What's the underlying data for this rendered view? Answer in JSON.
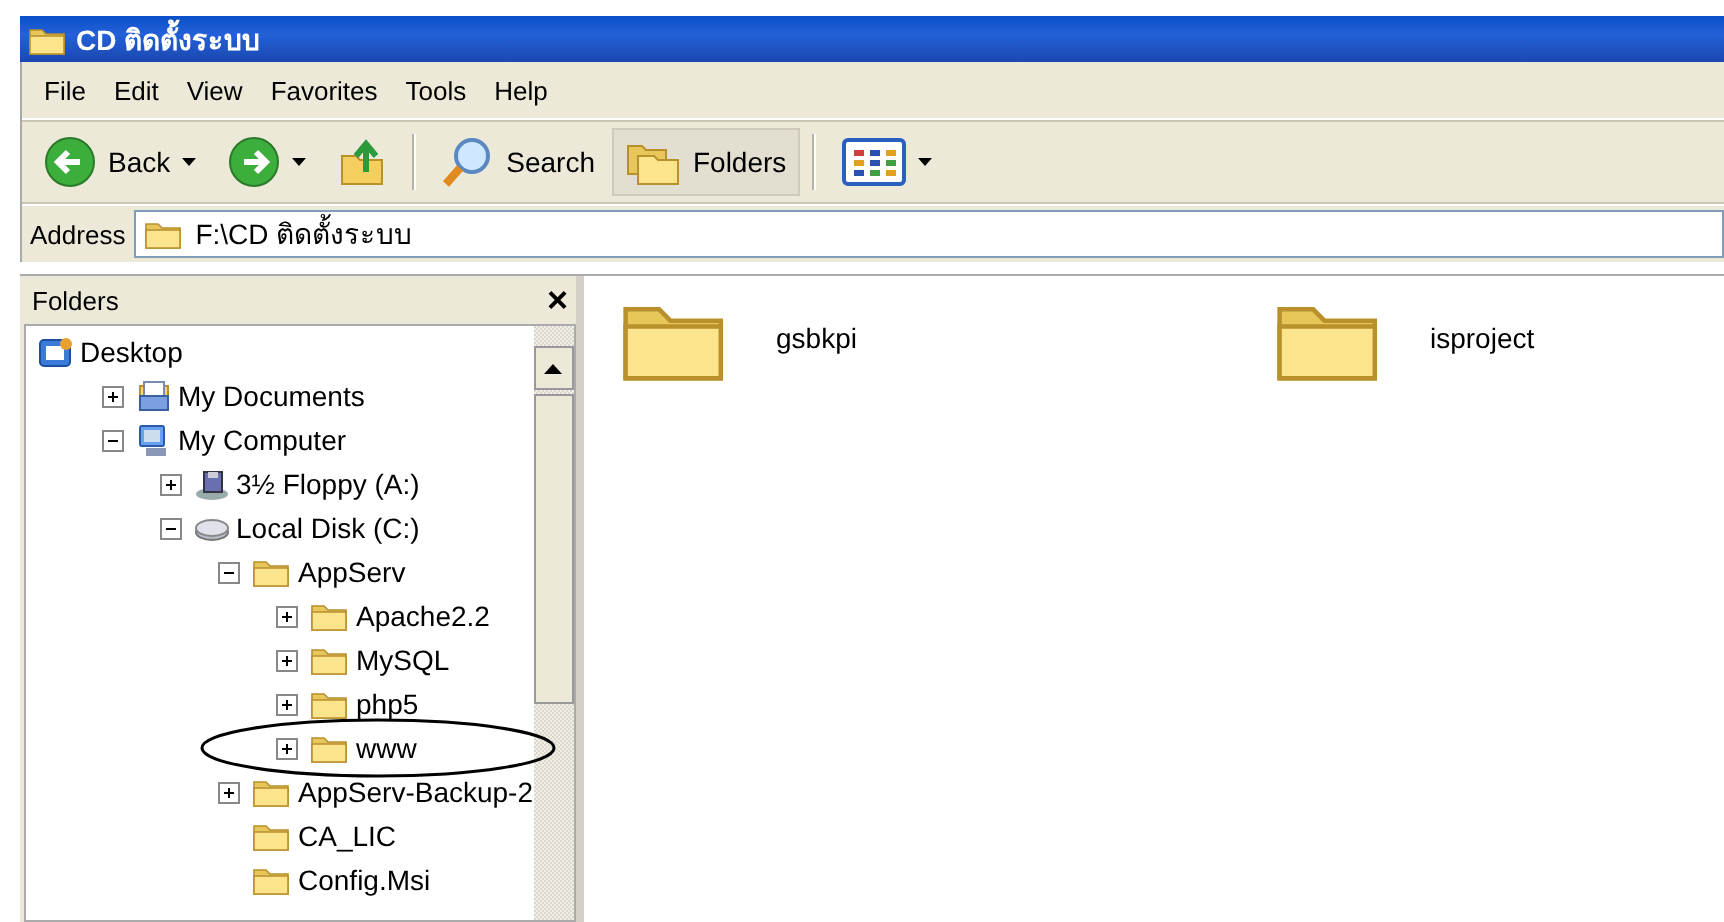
{
  "window": {
    "title": "CD ติดตั้งระบบ"
  },
  "menu": [
    "File",
    "Edit",
    "View",
    "Favorites",
    "Tools",
    "Help"
  ],
  "toolbar": [
    {
      "kind": "back",
      "label": "Back"
    },
    {
      "kind": "forward"
    },
    {
      "kind": "up"
    },
    {
      "kind": "separator"
    },
    {
      "kind": "search",
      "label": "Search",
      "pressed": false
    },
    {
      "kind": "folders",
      "label": "Folders",
      "pressed": true
    },
    {
      "kind": "separator"
    },
    {
      "kind": "views"
    }
  ],
  "address": {
    "label": "Address",
    "value": "F:\\CD ติดตั้งระบบ"
  },
  "folders_pane": {
    "title": "Folders",
    "close": "×",
    "tree": [
      {
        "label": "Desktop",
        "kind": "desktop",
        "children": [
          {
            "label": "My Documents",
            "kind": "documents",
            "expanded": false
          },
          {
            "label": "My Computer",
            "kind": "computer",
            "expanded": true,
            "children": [
              {
                "label": "3½ Floppy (A:)",
                "kind": "floppy",
                "expanded": false
              },
              {
                "label": "Local Disk (C:)",
                "kind": "disk",
                "expanded": true,
                "children": [
                  {
                    "label": "AppServ",
                    "kind": "folder",
                    "expanded": true,
                    "children": [
                      {
                        "label": "Apache2.2",
                        "kind": "folder",
                        "expanded": false
                      },
                      {
                        "label": "MySQL",
                        "kind": "folder",
                        "expanded": false
                      },
                      {
                        "label": "php5",
                        "kind": "folder",
                        "expanded": false
                      },
                      {
                        "label": "www",
                        "kind": "folder",
                        "expanded": false,
                        "circled": true
                      }
                    ]
                  },
                  {
                    "label": "AppServ-Backup-2",
                    "kind": "folder",
                    "expanded": false
                  },
                  {
                    "label": "CA_LIC",
                    "kind": "folder"
                  },
                  {
                    "label": "Config.Msi",
                    "kind": "folder"
                  }
                ]
              }
            ]
          }
        ]
      }
    ]
  },
  "content": {
    "items": [
      {
        "label": "gsbkpi"
      },
      {
        "label": "isproject"
      }
    ]
  }
}
